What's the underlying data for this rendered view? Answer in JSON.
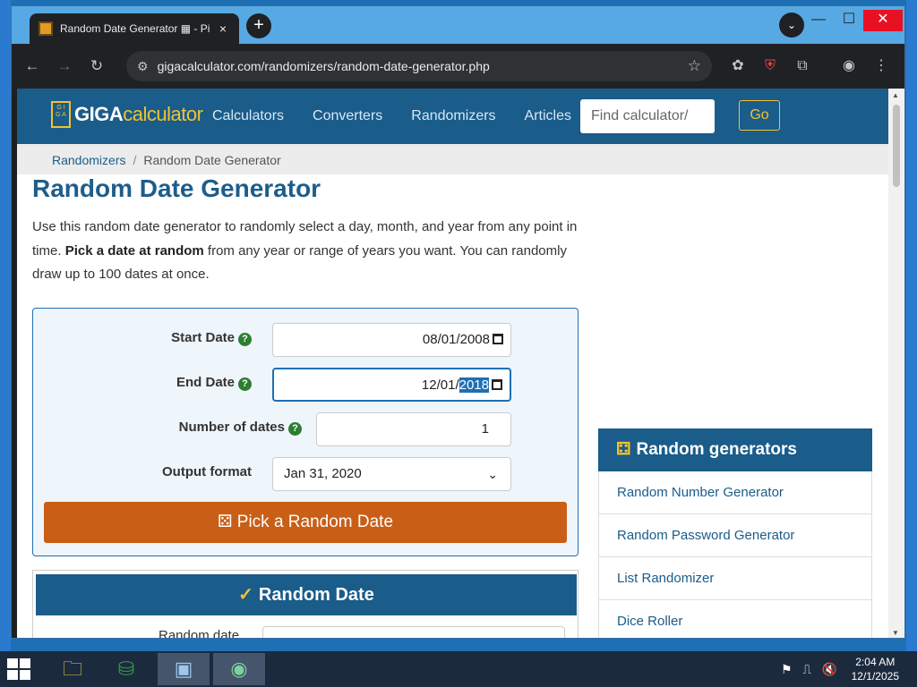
{
  "browser": {
    "tab_title": "Random Date Generator ▦ - Pi",
    "tab_close": "×",
    "new_tab": "+",
    "tab_search": "⌄",
    "url": "gigacalculator.com/randomizers/random-date-generator.php"
  },
  "site": {
    "logo_giga": "GIGA",
    "logo_calc": "calculator",
    "nav": [
      "Calculators",
      "Converters",
      "Randomizers",
      "Articles"
    ],
    "search_placeholder": "Find calculator/",
    "go": "Go",
    "breadcrumb": [
      "Randomizers",
      "Random Date Generator"
    ]
  },
  "page": {
    "title": "Random Date Generator",
    "intro_1": "Use this random date generator to randomly select a day, month, and year from any point in time. ",
    "intro_bold": "Pick a date at random",
    "intro_2": " from any year or range of years you want. You can randomly draw up to 100 dates at once."
  },
  "form": {
    "start_label": "Start Date",
    "start_value": "08/01/2008",
    "end_label": "End Date",
    "end_value_prefix": "12/01/",
    "end_value_selected": "2018",
    "count_label": "Number of dates",
    "count_value": "1",
    "format_label": "Output format",
    "format_value": "Jan 31, 2020",
    "help": "?",
    "pick_button": "Pick a Random Date"
  },
  "result": {
    "heading": "Random Date",
    "label": "Random date"
  },
  "sidebar": {
    "heading": "Random generators",
    "items": [
      "Random Number Generator",
      "Random Password Generator",
      "List Randomizer",
      "Dice Roller"
    ]
  },
  "taskbar": {
    "time": "2:04 AM",
    "date": "12/1/2025"
  },
  "colors": {
    "header": "#1a5c8a",
    "accent_button": "#c95e16",
    "logo_yellow": "#f2c230"
  }
}
